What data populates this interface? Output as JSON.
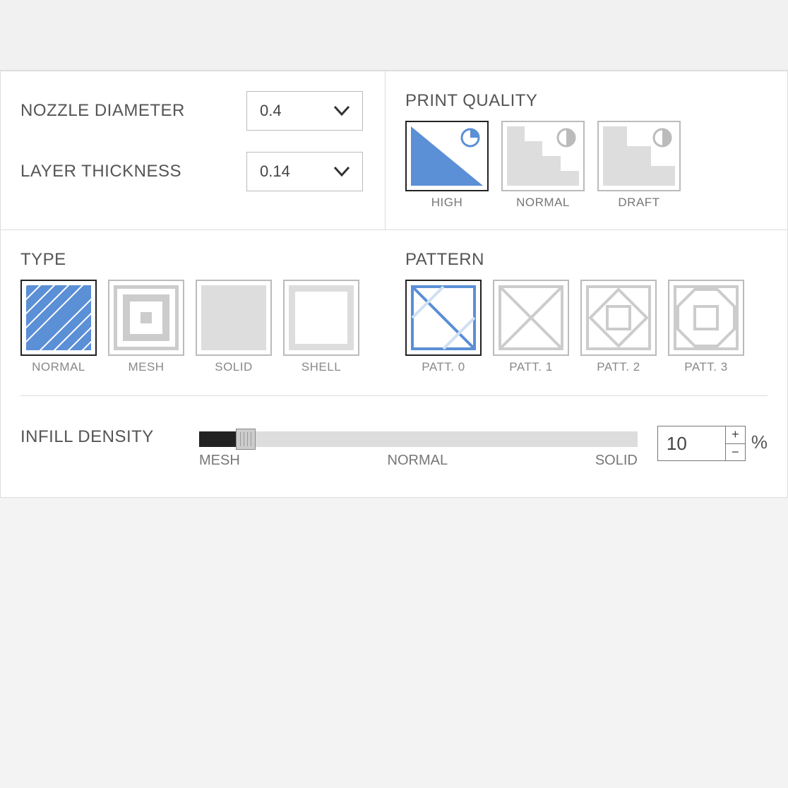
{
  "settings": {
    "nozzle_label": "NOZZLE DIAMETER",
    "nozzle_value": "0.4",
    "layer_label": "LAYER THICKNESS",
    "layer_value": "0.14"
  },
  "quality": {
    "title": "PRINT QUALITY",
    "options": [
      {
        "label": "HIGH",
        "selected": true
      },
      {
        "label": "NORMAL",
        "selected": false
      },
      {
        "label": "DRAFT",
        "selected": false
      }
    ]
  },
  "type": {
    "title": "TYPE",
    "options": [
      {
        "label": "NORMAL",
        "selected": true
      },
      {
        "label": "MESH",
        "selected": false
      },
      {
        "label": "SOLID",
        "selected": false
      },
      {
        "label": "SHELL",
        "selected": false
      }
    ]
  },
  "pattern": {
    "title": "PATTERN",
    "options": [
      {
        "label": "PATT. 0",
        "selected": true
      },
      {
        "label": "PATT. 1",
        "selected": false
      },
      {
        "label": "PATT. 2",
        "selected": false
      },
      {
        "label": "PATT. 3",
        "selected": false
      }
    ]
  },
  "infill": {
    "label": "INFILL DENSITY",
    "value": "10",
    "unit": "%",
    "slider_labels": {
      "min": "MESH",
      "mid": "NORMAL",
      "max": "SOLID"
    }
  }
}
